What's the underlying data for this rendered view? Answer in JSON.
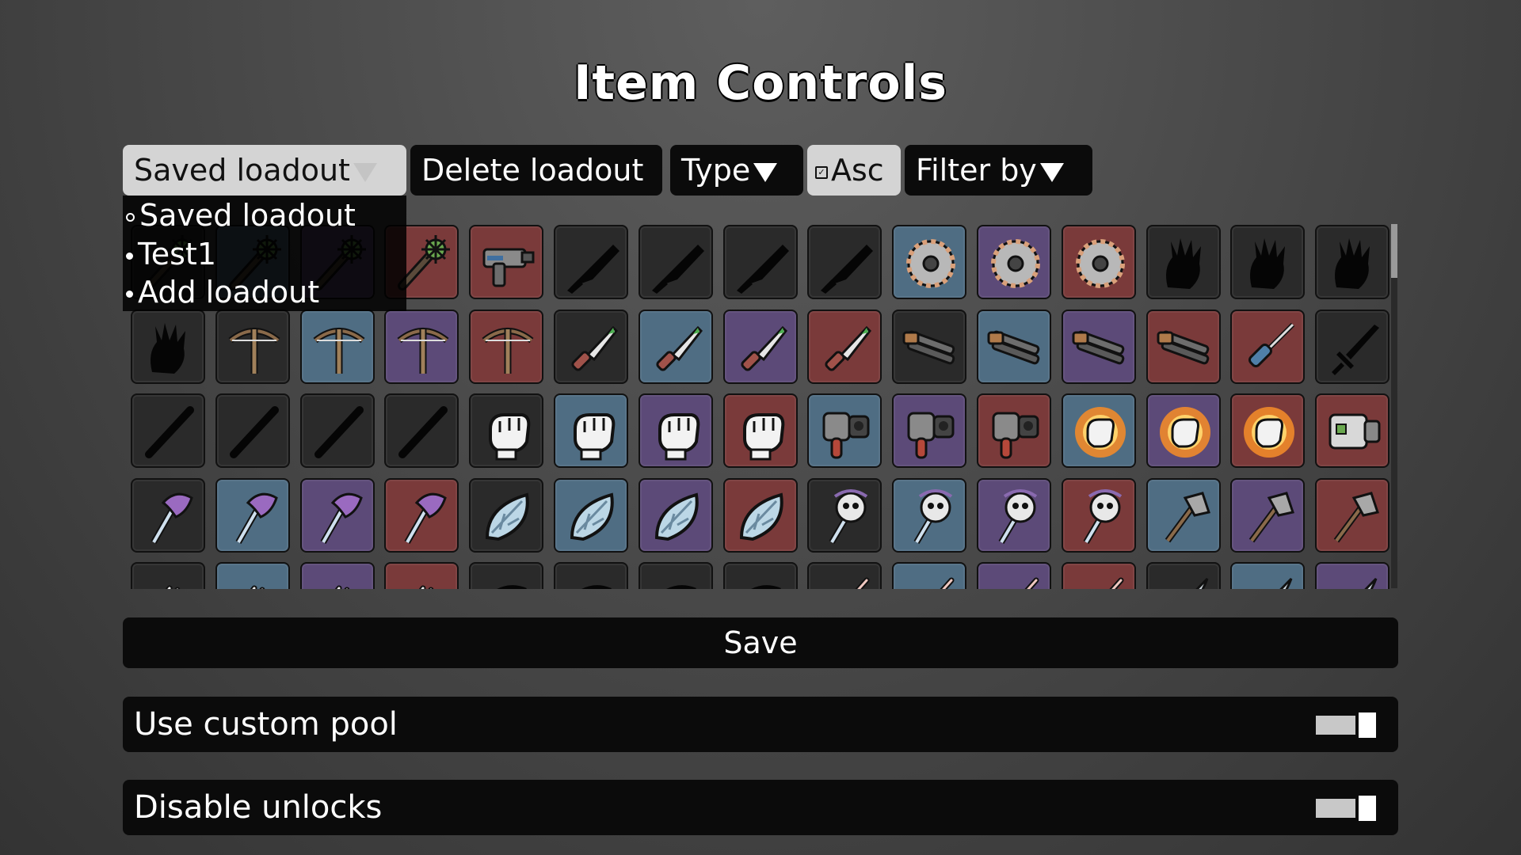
{
  "title": "Item Controls",
  "toolbar": {
    "loadout_select": "Saved loadout",
    "delete_label": "Delete loadout",
    "sort_label": "Type",
    "asc_label": "Asc",
    "asc_checked": true,
    "filter_label": "Filter by"
  },
  "loadout_options": [
    "Saved loadout",
    "Test1",
    "Add loadout"
  ],
  "rarity_colors": {
    "black": "#2a2a2a",
    "blue": "#4f6d83",
    "purple": "#5c4a78",
    "red": "#7a3a3a"
  },
  "items": [
    [
      {
        "icon": "spiked-club",
        "rarity": "black"
      },
      {
        "icon": "spiked-club",
        "rarity": "blue"
      },
      {
        "icon": "spiked-club",
        "rarity": "purple"
      },
      {
        "icon": "spiked-club",
        "rarity": "red"
      },
      {
        "icon": "nailgun",
        "rarity": "red"
      },
      {
        "icon": "cleaver-silhouette",
        "rarity": "black"
      },
      {
        "icon": "cleaver-silhouette",
        "rarity": "black"
      },
      {
        "icon": "cleaver-silhouette",
        "rarity": "black"
      },
      {
        "icon": "cleaver-silhouette",
        "rarity": "black"
      },
      {
        "icon": "sawblade",
        "rarity": "blue"
      },
      {
        "icon": "sawblade",
        "rarity": "purple"
      },
      {
        "icon": "sawblade",
        "rarity": "red"
      },
      {
        "icon": "claw-silhouette",
        "rarity": "black"
      },
      {
        "icon": "claw-silhouette",
        "rarity": "black"
      },
      {
        "icon": "claw-silhouette",
        "rarity": "black"
      }
    ],
    [
      {
        "icon": "claw-silhouette",
        "rarity": "black"
      },
      {
        "icon": "crossbow",
        "rarity": "black"
      },
      {
        "icon": "crossbow",
        "rarity": "blue"
      },
      {
        "icon": "crossbow",
        "rarity": "purple"
      },
      {
        "icon": "crossbow",
        "rarity": "red"
      },
      {
        "icon": "knife",
        "rarity": "black"
      },
      {
        "icon": "knife",
        "rarity": "blue"
      },
      {
        "icon": "knife",
        "rarity": "purple"
      },
      {
        "icon": "knife",
        "rarity": "red"
      },
      {
        "icon": "double-barrel",
        "rarity": "black"
      },
      {
        "icon": "double-barrel",
        "rarity": "blue"
      },
      {
        "icon": "double-barrel",
        "rarity": "purple"
      },
      {
        "icon": "double-barrel",
        "rarity": "red"
      },
      {
        "icon": "screwdriver",
        "rarity": "red"
      },
      {
        "icon": "sword-silhouette",
        "rarity": "black"
      }
    ],
    [
      {
        "icon": "stick-silhouette",
        "rarity": "black"
      },
      {
        "icon": "stick-silhouette",
        "rarity": "black"
      },
      {
        "icon": "stick-silhouette",
        "rarity": "black"
      },
      {
        "icon": "stick-silhouette",
        "rarity": "black"
      },
      {
        "icon": "fist",
        "rarity": "black"
      },
      {
        "icon": "fist",
        "rarity": "blue"
      },
      {
        "icon": "fist",
        "rarity": "purple"
      },
      {
        "icon": "fist",
        "rarity": "red"
      },
      {
        "icon": "blaster",
        "rarity": "blue"
      },
      {
        "icon": "blaster",
        "rarity": "purple"
      },
      {
        "icon": "blaster",
        "rarity": "red"
      },
      {
        "icon": "flame-fist",
        "rarity": "blue"
      },
      {
        "icon": "flame-fist",
        "rarity": "purple"
      },
      {
        "icon": "flame-fist",
        "rarity": "red"
      },
      {
        "icon": "gauntlet-cannon",
        "rarity": "red"
      }
    ],
    [
      {
        "icon": "purple-axe",
        "rarity": "black"
      },
      {
        "icon": "purple-axe",
        "rarity": "blue"
      },
      {
        "icon": "purple-axe",
        "rarity": "purple"
      },
      {
        "icon": "purple-axe",
        "rarity": "red"
      },
      {
        "icon": "crystal-leaf",
        "rarity": "black"
      },
      {
        "icon": "crystal-leaf",
        "rarity": "blue"
      },
      {
        "icon": "crystal-leaf",
        "rarity": "purple"
      },
      {
        "icon": "crystal-leaf",
        "rarity": "red"
      },
      {
        "icon": "skull-staff",
        "rarity": "black"
      },
      {
        "icon": "skull-staff",
        "rarity": "blue"
      },
      {
        "icon": "skull-staff",
        "rarity": "purple"
      },
      {
        "icon": "skull-staff",
        "rarity": "red"
      },
      {
        "icon": "hatchet",
        "rarity": "blue"
      },
      {
        "icon": "hatchet",
        "rarity": "purple"
      },
      {
        "icon": "hatchet",
        "rarity": "red"
      }
    ],
    [
      {
        "icon": "bone-claw",
        "rarity": "black"
      },
      {
        "icon": "bone-claw",
        "rarity": "blue"
      },
      {
        "icon": "bone-claw",
        "rarity": "purple"
      },
      {
        "icon": "bone-claw",
        "rarity": "red"
      },
      {
        "icon": "pickaxe-silhouette",
        "rarity": "black"
      },
      {
        "icon": "pickaxe-silhouette",
        "rarity": "black"
      },
      {
        "icon": "pickaxe-silhouette",
        "rarity": "black"
      },
      {
        "icon": "pickaxe-silhouette",
        "rarity": "black"
      },
      {
        "icon": "needle",
        "rarity": "black"
      },
      {
        "icon": "needle",
        "rarity": "blue"
      },
      {
        "icon": "needle",
        "rarity": "purple"
      },
      {
        "icon": "needle",
        "rarity": "red"
      },
      {
        "icon": "blade",
        "rarity": "black"
      },
      {
        "icon": "blade",
        "rarity": "blue"
      },
      {
        "icon": "blade",
        "rarity": "purple"
      }
    ]
  ],
  "save_label": "Save",
  "settings": {
    "custom_pool": {
      "label": "Use custom pool",
      "enabled": false
    },
    "disable_unlocks": {
      "label": "Disable unlocks",
      "enabled": false
    }
  }
}
